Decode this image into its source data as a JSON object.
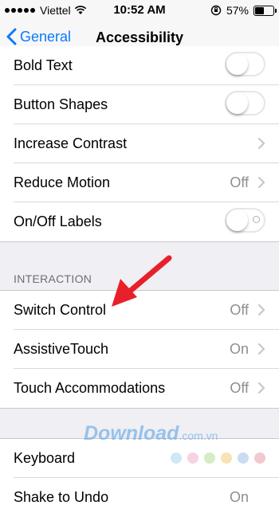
{
  "status_bar": {
    "carrier": "Viettel",
    "time": "10:52 AM",
    "battery": "57%",
    "battery_level": 0.57
  },
  "nav": {
    "back_label": "General",
    "title": "Accessibility"
  },
  "group1": {
    "rows": [
      {
        "label": "Bold Text",
        "control": "toggle",
        "on": false
      },
      {
        "label": "Button Shapes",
        "control": "toggle",
        "on": false
      },
      {
        "label": "Increase Contrast",
        "control": "chevron"
      },
      {
        "label": "Reduce Motion",
        "value": "Off",
        "control": "chevron"
      },
      {
        "label": "On/Off Labels",
        "control": "toggle",
        "on": false
      }
    ]
  },
  "interaction": {
    "header": "INTERACTION",
    "rows": [
      {
        "label": "Switch Control",
        "value": "Off"
      },
      {
        "label": "AssistiveTouch",
        "value": "On"
      },
      {
        "label": "Touch Accommodations",
        "value": "Off"
      }
    ]
  },
  "group3": {
    "rows": [
      {
        "label": "Keyboard"
      },
      {
        "label": "Shake to Undo",
        "value": "On"
      }
    ]
  },
  "watermark": {
    "brand": "Download",
    "suffix": ".com.vn",
    "dot_colors": [
      "#cfe8f7",
      "#f6d3e2",
      "#d6ecc4",
      "#f9e2b8",
      "#c9dcf3",
      "#f3c8cf"
    ]
  },
  "colors": {
    "accent": "#0a7aff",
    "annotation": "#e8202a"
  }
}
